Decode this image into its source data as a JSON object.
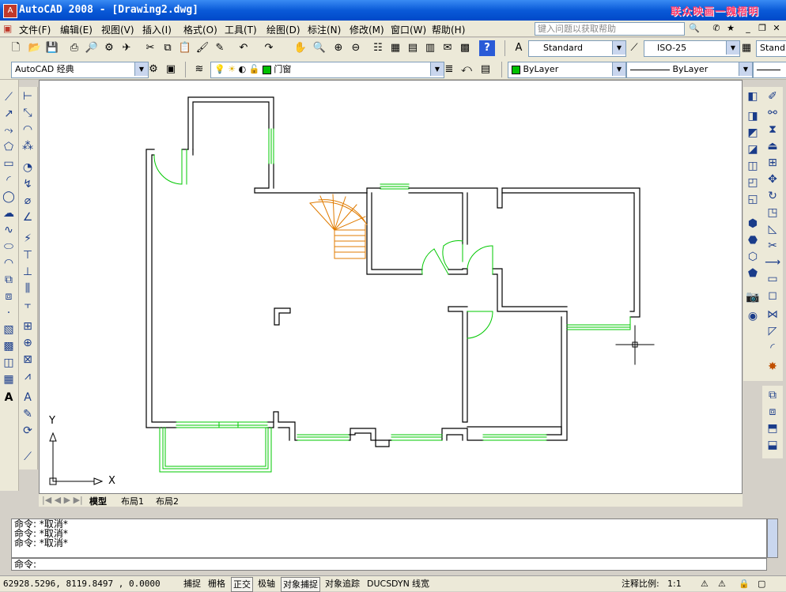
{
  "window": {
    "title": "AutoCAD 2008 - [Drawing2.dwg]",
    "brand_text": "联众映画一魏梧明",
    "minimize": "_",
    "restore": "❐",
    "close": "✕"
  },
  "menu": {
    "items": [
      "文件(F)",
      "编辑(E)",
      "视图(V)",
      "插入(I)",
      "格式(O)",
      "工具(T)",
      "绘图(D)",
      "标注(N)",
      "修改(M)",
      "窗口(W)",
      "帮助(H)"
    ],
    "help_placeholder": "键入问题以获取帮助"
  },
  "toolbar": {
    "text_style": "Standard",
    "dim_style": "ISO-25",
    "table_style": "Stand",
    "workspace": "AutoCAD 经典",
    "layer": "门窗",
    "color": "ByLayer",
    "linetype": "ByLayer"
  },
  "layout_tabs": [
    "模型",
    "布局1",
    "布局2"
  ],
  "command": {
    "history": [
      "命令: *取消*",
      "命令: *取消*",
      "命令: *取消*"
    ],
    "prompt": "命令:"
  },
  "status": {
    "coordinates": "62928.5296, 8119.8497 , 0.0000",
    "buttons": [
      "捕捉",
      "栅格",
      "正交",
      "极轴",
      "对象捕捉",
      "对象追踪",
      "DUCS",
      "DYN",
      "线宽"
    ],
    "annotation_scale_label": "注释比例:",
    "annotation_scale": "1:1"
  },
  "ucs": {
    "x_label": "X",
    "y_label": "Y"
  },
  "colors": {
    "title_bar": "#0a5ad8",
    "wall": "#000000",
    "door_window": "#00c800",
    "stair": "#e07b00",
    "bylayer_swatch": "#00c000"
  }
}
